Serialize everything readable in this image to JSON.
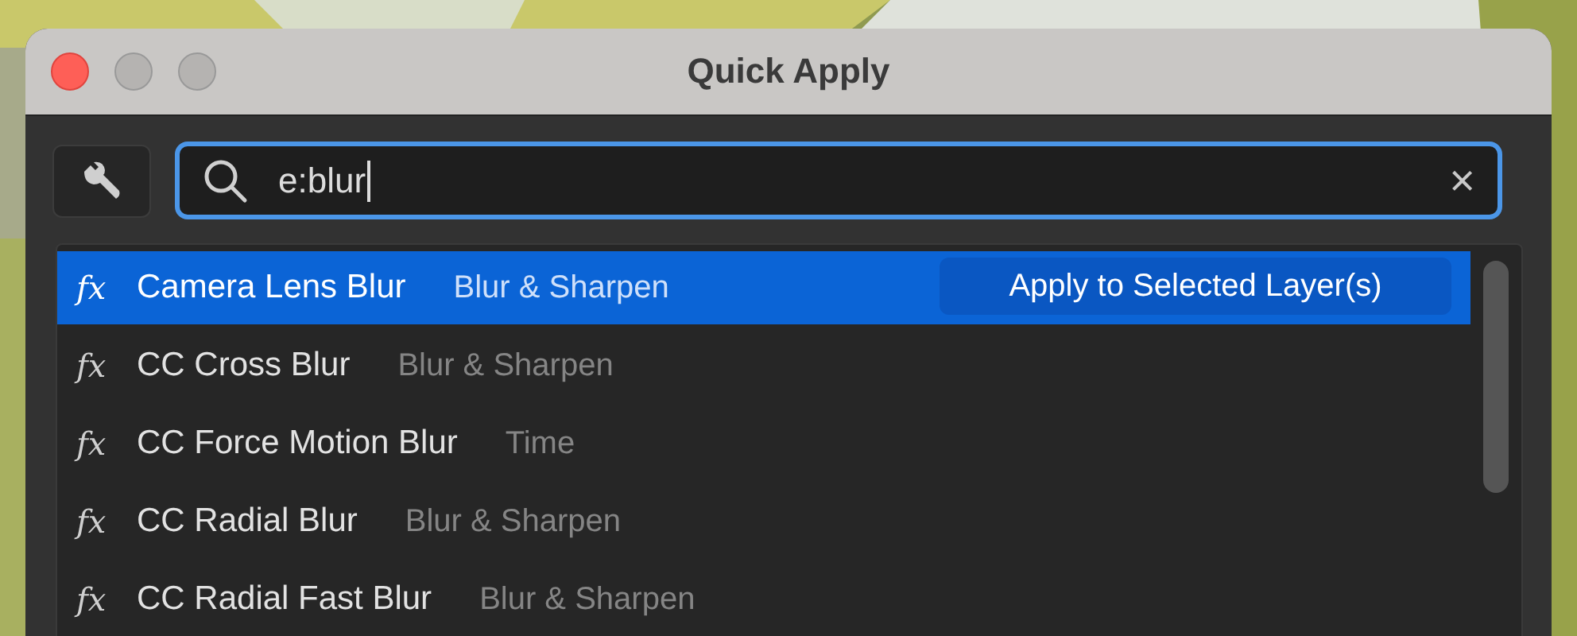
{
  "window": {
    "title": "Quick Apply"
  },
  "search": {
    "value": "e:blur",
    "clear": "×"
  },
  "results": [
    {
      "mark": "fx",
      "name": "Camera Lens Blur",
      "category": "Blur & Sharpen",
      "selected": true
    },
    {
      "mark": "fx",
      "name": "CC Cross Blur",
      "category": "Blur & Sharpen",
      "selected": false
    },
    {
      "mark": "fx",
      "name": "CC Force Motion Blur",
      "category": "Time",
      "selected": false
    },
    {
      "mark": "fx",
      "name": "CC Radial Blur",
      "category": "Blur & Sharpen",
      "selected": false
    },
    {
      "mark": "fx",
      "name": "CC Radial Fast Blur",
      "category": "Blur & Sharpen",
      "selected": false
    }
  ],
  "apply_button": {
    "label": "Apply to Selected Layer(s)"
  }
}
